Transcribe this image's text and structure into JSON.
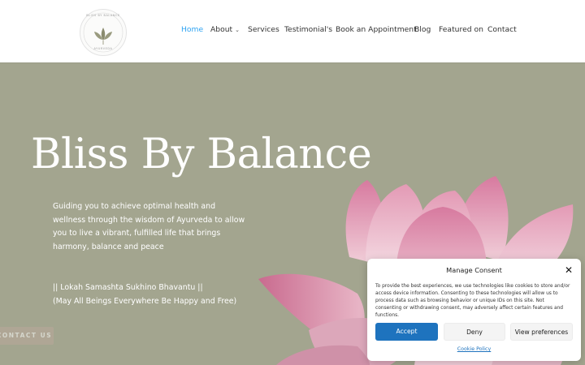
{
  "header": {
    "logo": {
      "top_text": "BLISS BY BALANCE",
      "bottom_text": "AYURVEDA",
      "icon": "lotus-leaf-logo-icon"
    },
    "nav": [
      {
        "label": "Home",
        "active": true
      },
      {
        "label": "About",
        "has_dropdown": true
      },
      {
        "label": "Services"
      },
      {
        "label": "Testimonial's"
      },
      {
        "label": "Book an Appointment"
      },
      {
        "label": "Blog"
      },
      {
        "label": "Featured on"
      },
      {
        "label": "Contact"
      }
    ],
    "dropdown_icon": "chevron-down-icon"
  },
  "hero": {
    "title": "Bliss By Balance",
    "description": "Guiding you to achieve optimal health and wellness through the wisdom of Ayurveda to allow you to live a vibrant, fulfilled life that brings harmony, balance and peace",
    "mantra_line1": "|| Lokah Samashta Sukhino Bhavantu ||",
    "mantra_line2": "(May All Beings Everywhere Be Happy and Free)",
    "cta_label": "CONTACT US",
    "background_color": "#a3a58f"
  },
  "consent": {
    "title": "Manage Consent",
    "text": "To provide the best experiences, we use technologies like cookies to store and/or access device information. Consenting to these technologies will allow us to process data such as browsing behavior or unique IDs on this site. Not consenting or withdrawing consent, may adversely affect certain features and functions.",
    "accept_label": "Accept",
    "deny_label": "Deny",
    "preferences_label": "View preferences",
    "policy_link": "Cookie Policy",
    "close_icon": "close-icon",
    "accent_color": "#1e73be"
  },
  "colors": {
    "nav_active": "#2ea3f2",
    "nav_text": "#333333"
  }
}
